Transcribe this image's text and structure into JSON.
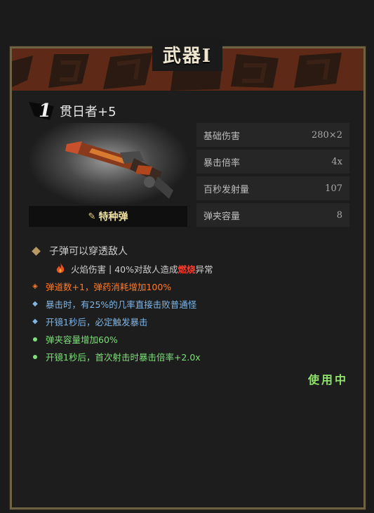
{
  "panel": {
    "title": "武器Ⅰ"
  },
  "weapon": {
    "tier": "1",
    "name": "贯日者+5",
    "ammo_type": "特种弹",
    "ammo_icon": "bullet-icon"
  },
  "stats": [
    {
      "label": "基础伤害",
      "value": "280×2"
    },
    {
      "label": "暴击倍率",
      "value": "4x"
    },
    {
      "label": "百秒发射量",
      "value": "107"
    },
    {
      "label": "弹夹容量",
      "value": "8"
    }
  ],
  "effect": {
    "main": "子弹可以穿透敌人",
    "damage_type": "火焰伤害",
    "separator": "|",
    "desc_prefix": "40%对敌人造成",
    "status": "燃烧",
    "desc_suffix": "异常"
  },
  "traits": [
    {
      "text": "弹道数+1，弹药消耗增加100%",
      "color": "#ff7a2a"
    },
    {
      "text": "暴击时，有25%的几率直接击败普通怪",
      "color": "#7fb6e8"
    },
    {
      "text": "开镜1秒后，必定触发暴击",
      "color": "#7fb6e8"
    },
    {
      "text": "弹夹容量增加60%",
      "color": "#7ee07a"
    },
    {
      "text": "开镜1秒后，首次射击时暴击倍率+2.0x",
      "color": "#7ee07a"
    }
  ],
  "status_label": "使用中",
  "colors": {
    "frame": "#6e6242",
    "banner": "#5e2a17",
    "burn": "#ff3a2a",
    "in_use": "#8fe26a"
  }
}
